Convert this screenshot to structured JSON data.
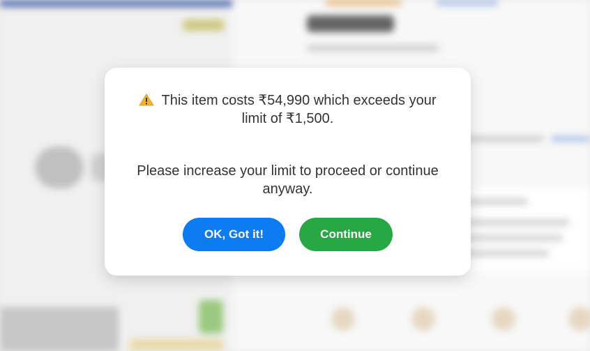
{
  "dialog": {
    "message_line": "This item costs ₹54,990 which exceeds your limit of ₹1,500.",
    "sub_message": "Please increase your limit to proceed or continue anyway.",
    "buttons": {
      "ok_label": "OK, Got it!",
      "continue_label": "Continue"
    }
  },
  "icons": {
    "warning": "warning-icon"
  },
  "colors": {
    "ok_button": "#0d7cf2",
    "continue_button": "#27a844",
    "warning_triangle": "#f2b233"
  }
}
